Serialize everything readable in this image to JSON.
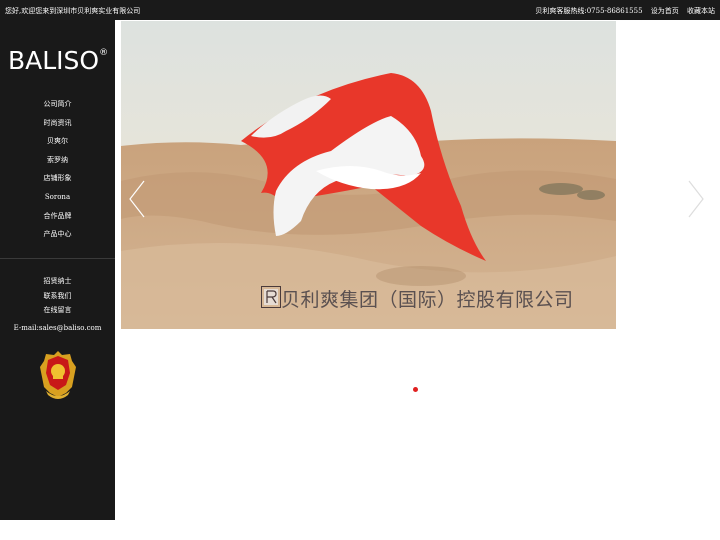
{
  "topbar": {
    "welcome": "您好,欢迎您来到深圳市贝利爽实业有限公司",
    "hotline": "贝利爽客服热线:0755-86861555",
    "set_home": "设为首页",
    "bookmark": "收藏本站"
  },
  "sidebar": {
    "logo": "BALISO",
    "logo_mark": "®",
    "nav": [
      {
        "label": "公司简介"
      },
      {
        "label": "时尚资讯"
      },
      {
        "label": "贝爽尔"
      },
      {
        "label": "索罗纳"
      },
      {
        "label": "店铺形象"
      },
      {
        "label": "Sorona"
      },
      {
        "label": "合作品牌"
      },
      {
        "label": "产品中心"
      }
    ],
    "nav2": [
      {
        "label": "招贤纳士"
      },
      {
        "label": "联系我们"
      },
      {
        "label": "在线留言"
      }
    ],
    "email": "E-mail:sales@baliso.com"
  },
  "banner": {
    "caption": "贝利爽集团（国际）控股有限公司",
    "slide_count": 1,
    "active_slide": 1
  },
  "colors": {
    "sidebar_bg": "#191919",
    "topbar_bg": "#1a1a1a",
    "accent": "#e02020",
    "sky": "#dfe3e0",
    "sand": "#c8a583"
  },
  "icons": [
    "prev-arrow-icon",
    "next-arrow-icon",
    "police-emblem-icon",
    "company-logo-icon"
  ]
}
